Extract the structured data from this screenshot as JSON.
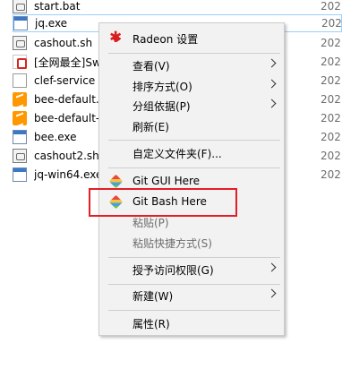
{
  "files": [
    {
      "name": "start.bat",
      "date": "202",
      "icon": "bat-icon"
    },
    {
      "name": "jq.exe",
      "date": "202",
      "icon": "exe-icon",
      "selected": true
    },
    {
      "name": "cashout.sh",
      "date": "202",
      "icon": "script-icon"
    },
    {
      "name": "[全网最全]Sw",
      "date": "202",
      "icon": "pdf-icon"
    },
    {
      "name": "clef-service",
      "date": "202",
      "icon": "file-icon"
    },
    {
      "name": "bee-default.",
      "date": "202",
      "icon": "sublime-icon"
    },
    {
      "name": "bee-default-",
      "date": "202",
      "icon": "sublime-icon"
    },
    {
      "name": "bee.exe",
      "date": "202",
      "icon": "exe-icon"
    },
    {
      "name": "cashout2.sh",
      "date": "202",
      "icon": "script-icon"
    },
    {
      "name": "jq-win64.exe",
      "date": "202",
      "icon": "exe-icon"
    }
  ],
  "menu": {
    "radeon": "Radeon 设置",
    "view": "查看(V)",
    "sort": "排序方式(O)",
    "group": "分组依据(P)",
    "refresh": "刷新(E)",
    "customize": "自定义文件夹(F)...",
    "git_gui": "Git GUI Here",
    "git_bash": "Git Bash Here",
    "paste": "粘贴(P)",
    "paste_shortcut": "粘贴快捷方式(S)",
    "grant_access": "授予访问权限(G)",
    "new": "新建(W)",
    "properties": "属性(R)"
  },
  "colors": {
    "highlight_border": "#e21f26",
    "menu_bg": "#f2f2f2",
    "disabled_text": "#6d6d6d"
  }
}
